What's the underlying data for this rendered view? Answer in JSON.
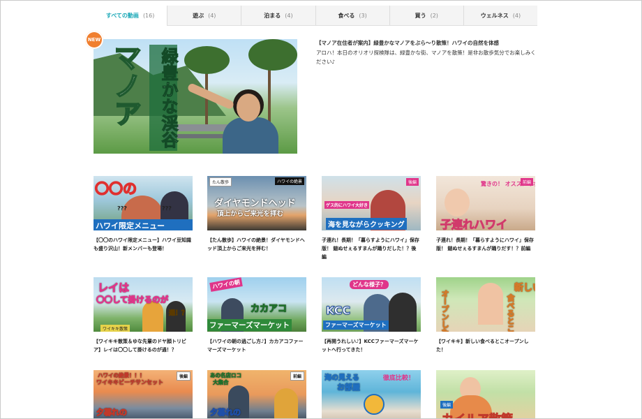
{
  "tabs": [
    {
      "label": "すべての動画",
      "count": "(16)"
    },
    {
      "label": "遊ぶ",
      "count": "(4)"
    },
    {
      "label": "泊まる",
      "count": "(4)"
    },
    {
      "label": "食べる",
      "count": "(3)"
    },
    {
      "label": "買う",
      "count": "(2)"
    },
    {
      "label": "ウェルネス",
      "count": "(4)"
    }
  ],
  "featured": {
    "badge": "NEW",
    "overlay_main": "マノア",
    "overlay_sub": "緑豊かな渓谷",
    "title": "【マノア在住者が案内】緑豊かなマノアをぶら〜り散策！ハワイの自然を体感",
    "description": "アロハ！本日のオリオリ探検隊は、緑豊かな街、マノアを散策！是非お散歩気分でお楽しみください♪"
  },
  "cards": [
    {
      "caption": "【〇〇のハワイ限定メニュー】ハワイ豆知識も盛り沢山！新メンバーも登場！",
      "ol1": "〇〇の",
      "ol2": "ハワイ限定メニュー",
      "ol3": "???"
    },
    {
      "caption": "【たん散歩】ハワイの絶景！ダイヤモンドヘッド頂上からご来光を拝む！",
      "ol1": "ダイヤモンドヘッド",
      "ol2": "頂上からご来光を拝む",
      "tag1": "たん散歩",
      "tag2": "ハワイの絶景"
    },
    {
      "caption": "子連れ！長期！「暮らすようにハワイ」保存版！ 鎚ぬせぇるすまんが踊りだした！？後編",
      "ol1": "海を見ながらクッキング",
      "ol2": "ゲス的にハワイ大好き",
      "tag1": "後編"
    },
    {
      "caption": "子連れ！長期！「暮らすようにハワイ」保存版！ 鎚ぬせぇるすまんが踊りだす！？前編",
      "ol1": "子連れハワイ",
      "ol2": "驚きの！ オススメのホテルとは！？",
      "tag1": "前編"
    },
    {
      "caption": "【ワイキキ散策＆ゆな先輩のドヤ顔トリビア】レイは〇〇して掛けるのが通！？",
      "ol1": "レイは",
      "ol2": "〇〇して掛けるのが",
      "ol3": "通！？",
      "tag1": "ワイキキ散策"
    },
    {
      "caption": "【ハワイの朝の過ごし方♪】カカアコファーマーズマーケット",
      "ol1": "ハワイの朝",
      "ol2": "カカアコ",
      "ol3": "ファーマーズマーケット"
    },
    {
      "caption": "【再開うれしい♪】KCCファーマーズマーケットへ行ってきた！",
      "ol1": "KCC",
      "ol2": "ファーマーズマーケット",
      "ol3": "どんな様子？"
    },
    {
      "caption": "【ワイキキ】新しい食べるとこオープンした！",
      "ol1": "新しい",
      "ol2": "食べるとこ",
      "ol3": "オープンした！"
    },
    {
      "caption": "",
      "ol1": "ハワイの絶景！！！",
      "ol2": "ワイキキビーチサンセット",
      "ol3": "夕暮れの",
      "tag1": "後編"
    },
    {
      "caption": "",
      "ol1": "あの名店ロコ",
      "ol2": "大集合",
      "ol3": "夕暮れの",
      "tag1": "前編"
    },
    {
      "caption": "",
      "ol1": "海の見える",
      "ol2": "お部屋",
      "ol3": "徹底比較！"
    },
    {
      "caption": "",
      "ol1": "カイルア散策",
      "tag1": "後編"
    }
  ]
}
